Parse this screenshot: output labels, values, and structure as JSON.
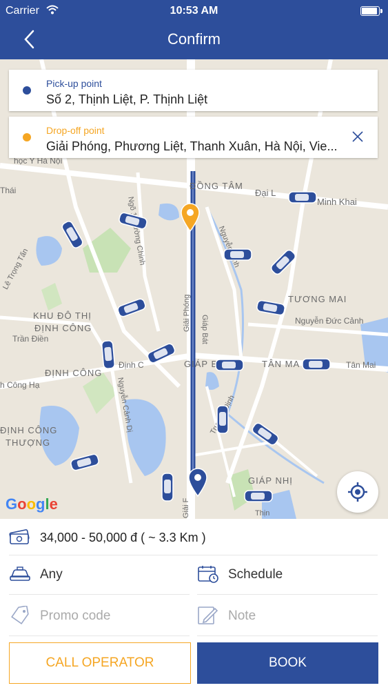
{
  "status_bar": {
    "carrier": "Carrier",
    "time": "10:53 AM"
  },
  "header": {
    "title": "Confirm"
  },
  "pickup": {
    "label": "Pick-up point",
    "value": "Số 2, Thịnh Liệt, P. Thịnh Liệt",
    "color": "#2d4e9b"
  },
  "dropoff": {
    "label": "Drop-off point",
    "value": "Giải Phóng, Phương Liệt, Thanh Xuân, Hà Nội, Vie...",
    "color": "#f5a623"
  },
  "map": {
    "labels": {
      "dong_tam": "ĐỒNG TÂM",
      "dai_la": "Đại L",
      "minh_khai": "Minh Khai",
      "tuong_mai": "TƯƠNG MAI",
      "nguyen_duc_canh": "Nguyễn Đức Cảnh",
      "khu_do_thi": "KHU ĐÔ THỊ",
      "dinh_cong_a": "ĐỊNH CÔNG",
      "dinh_cong_b": "ĐỊNH CÔNG",
      "tran_dien": "Trần Điền",
      "dinh_cong_road": "Định C",
      "giap_bat": "GIÁP B",
      "tan_mai_area": "TÂN MA",
      "tan_mai": "Tân Mai",
      "dinh_cong_thuong_a": "ĐỊNH CÔNG",
      "dinh_cong_thuong_b": "THƯỢNG",
      "giap_nhi": "GIÁP NHỊ",
      "thai": "Thái",
      "le_trong_tan": "Lê Trọng Tấn",
      "cong_ha": "h Công Hạ",
      "giai_phong": "Giải Phóng",
      "giap_bat_road": "Giáp Bát",
      "truong_dinh": "Trương Định",
      "nguyen_canh_di": "Nguyễn Cảnh Dị",
      "truong_chinh": "Ngõ 1 Trường Chinh",
      "nguyen_ninh": "Nguyễn Ninh",
      "giai_bottom": "Giải F",
      "hoc_y": "học Y Hà Nội",
      "thinh": "Thịn"
    },
    "brand": [
      "G",
      "o",
      "o",
      "g",
      "l",
      "e"
    ]
  },
  "fare": {
    "text": "34,000 - 50,000 đ  ( ~ 3.3 Km )"
  },
  "options": {
    "vehicle": "Any",
    "schedule": "Schedule",
    "promo_placeholder": "Promo code",
    "note_placeholder": "Note"
  },
  "buttons": {
    "call_operator": "CALL OPERATOR",
    "book": "BOOK"
  },
  "colors": {
    "primary": "#2d4e9b",
    "accent": "#f5a623"
  }
}
